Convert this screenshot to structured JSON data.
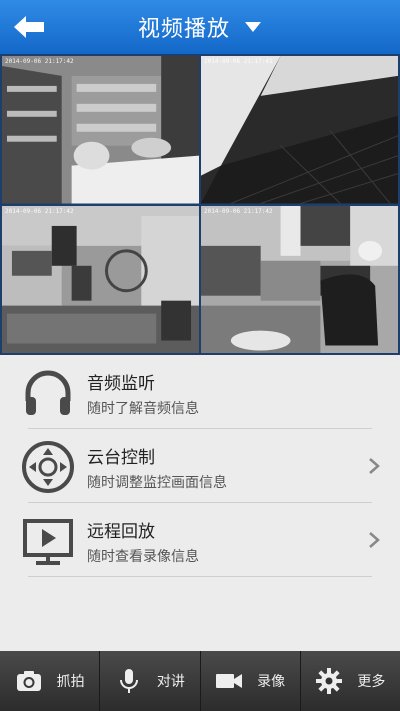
{
  "header": {
    "title": "视频播放"
  },
  "cameras": [
    {
      "timestamp": "2014-09-06 21:17:42"
    },
    {
      "timestamp": "2014-09-06 21:17:41"
    },
    {
      "timestamp": "2014-09-06 21:17:42"
    },
    {
      "timestamp": "2014-09-06 21:17:42"
    }
  ],
  "menu": {
    "items": [
      {
        "title": "音频监听",
        "subtitle": "随时了解音频信息",
        "icon": "headphones-icon"
      },
      {
        "title": "云台控制",
        "subtitle": "随时调整监控画面信息",
        "icon": "ptz-control-icon"
      },
      {
        "title": "远程回放",
        "subtitle": "随时查看录像信息",
        "icon": "playback-icon"
      }
    ]
  },
  "toolbar": {
    "capture": "抓拍",
    "talk": "对讲",
    "record": "录像",
    "more": "更多"
  },
  "colors": {
    "header": "#1f78d6",
    "grid_border": "#1e3f6e",
    "toolbar": "#333333",
    "background": "#ececec"
  }
}
